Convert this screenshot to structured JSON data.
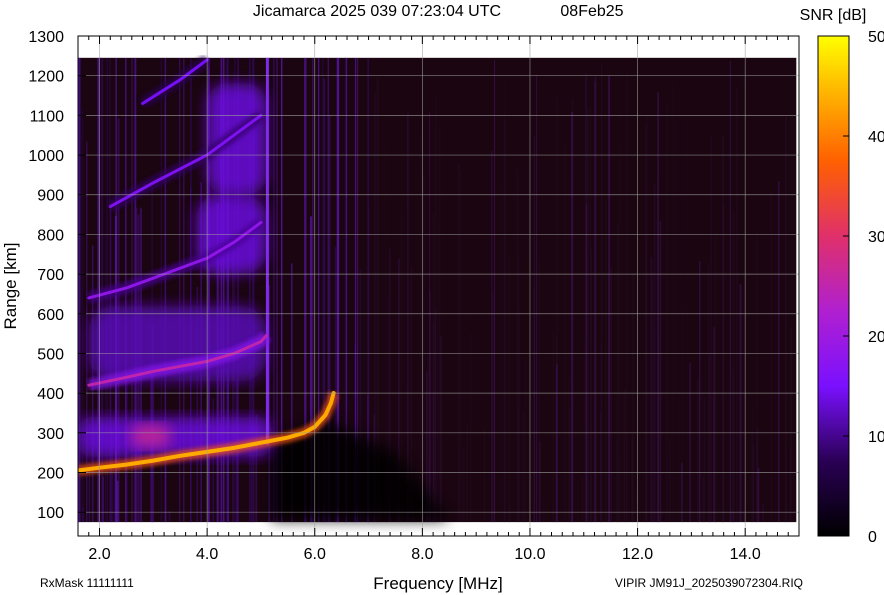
{
  "header": {
    "title": "Jicamarca 2025 039 07:23:04 UTC",
    "date": "08Feb25"
  },
  "footer": {
    "rxmask": "RxMask 11111111",
    "file": "VIPIR  JM91J_2025039072304.RIQ"
  },
  "chart_data": {
    "type": "heatmap",
    "title": "Jicamarca 2025 039 07:23:04 UTC",
    "xlabel": "Frequency [MHz]",
    "ylabel": "Range [km]",
    "xlim": [
      1.6,
      15.0
    ],
    "ylim": [
      40,
      1300
    ],
    "x_ticks": [
      2,
      4,
      6,
      8,
      10,
      12,
      14
    ],
    "x_tick_labels": [
      "2.0",
      "4.0",
      "6.0",
      "8.0",
      "10.0",
      "12.0",
      "14.0"
    ],
    "y_ticks": [
      100,
      200,
      300,
      400,
      500,
      600,
      700,
      800,
      900,
      1000,
      1100,
      1200,
      1300
    ],
    "y_tick_labels": [
      "100",
      "200",
      "300",
      "400",
      "500",
      "600",
      "700",
      "800",
      "900",
      "1000",
      "1100",
      "1200",
      "1300"
    ],
    "grid": true,
    "colorbar": {
      "label": "SNR [dB]",
      "range": [
        0,
        50
      ],
      "ticks": [
        0,
        10,
        20,
        30,
        40,
        50
      ],
      "tick_labels": [
        "0",
        "10",
        "20",
        "30",
        "40",
        "50"
      ],
      "colormap": [
        "#000000",
        "#3c0070",
        "#7a10ff",
        "#cc2aa0",
        "#ff5a00",
        "#ffb000",
        "#ffff00"
      ]
    },
    "data_extent": {
      "x": [
        1.6,
        14.95
      ],
      "y": [
        75,
        1245
      ]
    },
    "traces": [
      {
        "name": "1st hop O-trace",
        "snr_db": 44,
        "points": [
          [
            1.6,
            205
          ],
          [
            2.0,
            212
          ],
          [
            2.5,
            220
          ],
          [
            3.0,
            230
          ],
          [
            3.5,
            242
          ],
          [
            4.0,
            252
          ],
          [
            4.5,
            262
          ],
          [
            5.0,
            275
          ],
          [
            5.5,
            288
          ],
          [
            5.8,
            300
          ],
          [
            6.0,
            315
          ],
          [
            6.2,
            345
          ],
          [
            6.3,
            375
          ],
          [
            6.35,
            400
          ]
        ]
      },
      {
        "name": "2nd hop",
        "snr_db": 25,
        "points": [
          [
            1.8,
            420
          ],
          [
            2.5,
            440
          ],
          [
            3.0,
            455
          ],
          [
            4.0,
            480
          ],
          [
            4.5,
            500
          ],
          [
            5.0,
            530
          ],
          [
            5.1,
            545
          ]
        ]
      },
      {
        "name": "3rd hop",
        "snr_db": 18,
        "points": [
          [
            1.8,
            640
          ],
          [
            2.5,
            665
          ],
          [
            3.0,
            690
          ],
          [
            4.0,
            740
          ],
          [
            4.5,
            780
          ],
          [
            5.0,
            830
          ]
        ]
      },
      {
        "name": "4th hop",
        "snr_db": 16,
        "points": [
          [
            2.2,
            870
          ],
          [
            3.0,
            930
          ],
          [
            4.0,
            1000
          ],
          [
            4.6,
            1060
          ],
          [
            5.0,
            1100
          ]
        ]
      },
      {
        "name": "5th hop",
        "snr_db": 15,
        "points": [
          [
            2.8,
            1130
          ],
          [
            3.5,
            1190
          ],
          [
            4.0,
            1240
          ]
        ]
      }
    ],
    "patches": [
      {
        "name": "spread echo low",
        "freq": [
          1.6,
          5.2
        ],
        "range": [
          240,
          340
        ],
        "snr_db": 14
      },
      {
        "name": "hot spot",
        "freq": [
          2.6,
          3.3
        ],
        "range": [
          265,
          320
        ],
        "snr_db": 27
      },
      {
        "name": "spread hop 2",
        "freq": [
          1.8,
          5.1
        ],
        "range": [
          430,
          620
        ],
        "snr_db": 12
      },
      {
        "name": "spread hop 3",
        "freq": [
          3.8,
          5.1
        ],
        "range": [
          700,
          900
        ],
        "snr_db": 14
      },
      {
        "name": "spread hop 4",
        "freq": [
          4.0,
          5.1
        ],
        "range": [
          900,
          1180
        ],
        "snr_db": 14
      }
    ]
  }
}
